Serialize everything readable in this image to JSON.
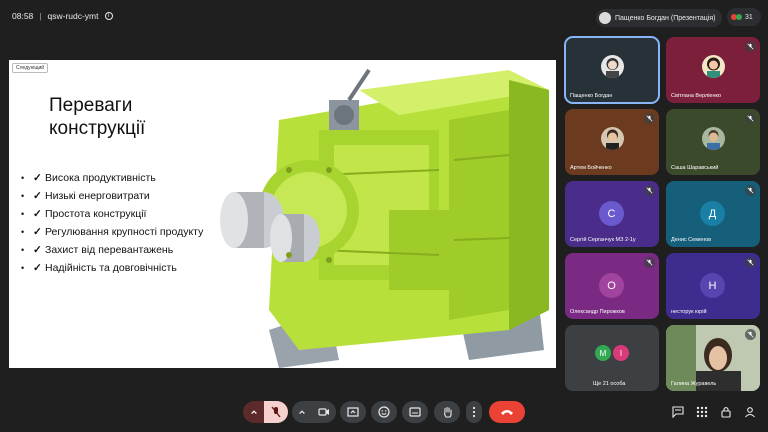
{
  "meeting": {
    "time": "08:58",
    "separator": "|",
    "code": "qsw-rudc-ymt"
  },
  "presenter_chip": {
    "label": "Пащенко Богдан (Презентація)"
  },
  "people_count": "31",
  "slide": {
    "badge": "Следующий",
    "title_line1": "Переваги",
    "title_line2": "конструкції",
    "bullets": [
      "Висока продуктивність",
      "Низькі енерговитрати",
      "Простота конструкції",
      "Регулювання крупності продукту",
      "Захист від перевантажень",
      "Надійність та довговічність"
    ],
    "check_symbol": "✓",
    "bullet_symbol": "•"
  },
  "participants": [
    {
      "name": "Пащенко Богдан",
      "kind": "photo",
      "muted": false
    },
    {
      "name": "Світлана Верліенко",
      "kind": "photo",
      "muted": true
    },
    {
      "name": "Артем Бойченко",
      "kind": "photo",
      "muted": true
    },
    {
      "name": "Саша Шаравський",
      "kind": "photo",
      "muted": true
    },
    {
      "name": "Сергій Серганчук МЗ 2-1у",
      "kind": "letter",
      "letter": "С",
      "muted": true
    },
    {
      "name": "Денис Семенов",
      "kind": "letter",
      "letter": "Д",
      "muted": true
    },
    {
      "name": "Олександр Пирожков",
      "kind": "letter",
      "letter": "О",
      "muted": true
    },
    {
      "name": "несторук юрій",
      "kind": "letter",
      "letter": "Н",
      "muted": true
    },
    {
      "name": "Ще 21 особа",
      "kind": "group",
      "letters": [
        "M",
        "I"
      ],
      "muted": false
    },
    {
      "name": "Галина Журавель",
      "kind": "video",
      "muted": true
    }
  ],
  "colors": {
    "tile_photo_1": "#263238",
    "tile_photo_2": "#7b1f3a",
    "tile_photo_3": "#6b3a1f",
    "tile_photo_4": "#3b4a2a",
    "tile_purple": "#4a2c8a",
    "tile_teal": "#155f7a",
    "tile_magenta": "#7a2a83",
    "tile_indigo": "#3f2c8f",
    "tile_gray": "#3c4043",
    "end_call": "#ea4335",
    "mic_off_bg": "#f6d0cc",
    "accent": "#8ab4f8",
    "machine_green": "#b8e03a"
  },
  "controls": {
    "chevron-left": "chevron-up-icon",
    "mic": "mic-off-icon",
    "cam": "camera-icon",
    "present": "present-icon",
    "emoji": "emoji-icon",
    "captions": "captions-icon",
    "hand": "raise-hand-icon",
    "more": "more-icon",
    "end": "end-call-icon"
  }
}
